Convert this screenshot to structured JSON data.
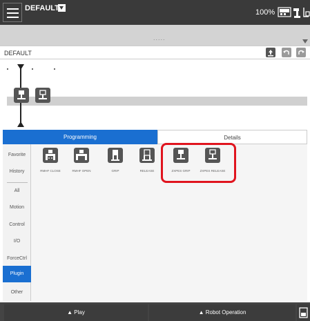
{
  "header": {
    "project": "DEFAULT",
    "speed": "100%",
    "mode_icon": "auto-mode-icon"
  },
  "subheader": {
    "dots": "....."
  },
  "timeline": {
    "name": "DEFAULT"
  },
  "tabs": [
    {
      "label": "Programming"
    },
    {
      "label": "Details"
    }
  ],
  "sidebar": {
    "items": [
      {
        "label": "Favorite"
      },
      {
        "label": "History"
      },
      {
        "label": "All"
      },
      {
        "label": "Motion"
      },
      {
        "label": "Control"
      },
      {
        "label": "I/O"
      },
      {
        "label": "ForceCtrl"
      },
      {
        "label": "Plugin"
      },
      {
        "label": "Other"
      }
    ]
  },
  "commands": [
    {
      "label": "RMHF CLOSE",
      "icon": "gripper-close-icon"
    },
    {
      "label": "RMHF OPEN",
      "icon": "gripper-open-icon"
    },
    {
      "label": "GRIP",
      "icon": "grip-icon"
    },
    {
      "label": "RELEASE",
      "icon": "release-icon"
    },
    {
      "label": "ZXPES GRIP",
      "icon": "zxpes-grip-icon"
    },
    {
      "label": "ZXPES RELEASE",
      "icon": "zxpes-release-icon"
    }
  ],
  "footer": {
    "play": "▲ Play",
    "robot": "▲ Robot Operation"
  },
  "colors": {
    "accent": "#1a6fd1",
    "highlight": "#e0141e",
    "topbar": "#3a3a3a"
  }
}
